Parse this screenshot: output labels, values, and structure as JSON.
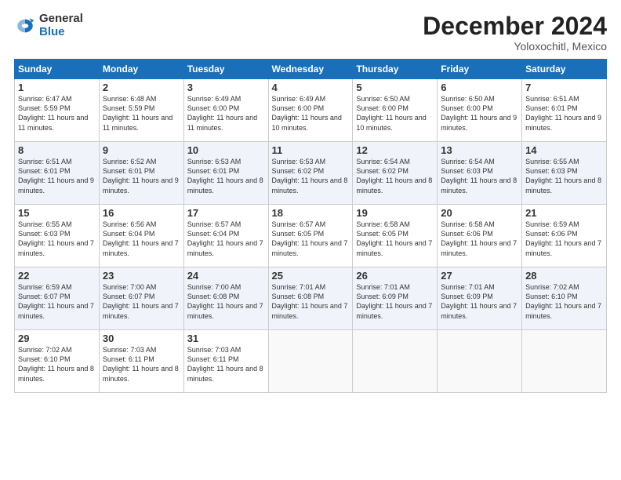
{
  "logo": {
    "general": "General",
    "blue": "Blue"
  },
  "title": "December 2024",
  "location": "Yoloxochitl, Mexico",
  "days_of_week": [
    "Sunday",
    "Monday",
    "Tuesday",
    "Wednesday",
    "Thursday",
    "Friday",
    "Saturday"
  ],
  "weeks": [
    [
      {
        "day": "1",
        "sunrise": "6:47 AM",
        "sunset": "5:59 PM",
        "daylight": "11 hours and 11 minutes."
      },
      {
        "day": "2",
        "sunrise": "6:48 AM",
        "sunset": "5:59 PM",
        "daylight": "11 hours and 11 minutes."
      },
      {
        "day": "3",
        "sunrise": "6:49 AM",
        "sunset": "6:00 PM",
        "daylight": "11 hours and 11 minutes."
      },
      {
        "day": "4",
        "sunrise": "6:49 AM",
        "sunset": "6:00 PM",
        "daylight": "11 hours and 10 minutes."
      },
      {
        "day": "5",
        "sunrise": "6:50 AM",
        "sunset": "6:00 PM",
        "daylight": "11 hours and 10 minutes."
      },
      {
        "day": "6",
        "sunrise": "6:50 AM",
        "sunset": "6:00 PM",
        "daylight": "11 hours and 9 minutes."
      },
      {
        "day": "7",
        "sunrise": "6:51 AM",
        "sunset": "6:01 PM",
        "daylight": "11 hours and 9 minutes."
      }
    ],
    [
      {
        "day": "8",
        "sunrise": "6:51 AM",
        "sunset": "6:01 PM",
        "daylight": "11 hours and 9 minutes."
      },
      {
        "day": "9",
        "sunrise": "6:52 AM",
        "sunset": "6:01 PM",
        "daylight": "11 hours and 9 minutes."
      },
      {
        "day": "10",
        "sunrise": "6:53 AM",
        "sunset": "6:01 PM",
        "daylight": "11 hours and 8 minutes."
      },
      {
        "day": "11",
        "sunrise": "6:53 AM",
        "sunset": "6:02 PM",
        "daylight": "11 hours and 8 minutes."
      },
      {
        "day": "12",
        "sunrise": "6:54 AM",
        "sunset": "6:02 PM",
        "daylight": "11 hours and 8 minutes."
      },
      {
        "day": "13",
        "sunrise": "6:54 AM",
        "sunset": "6:03 PM",
        "daylight": "11 hours and 8 minutes."
      },
      {
        "day": "14",
        "sunrise": "6:55 AM",
        "sunset": "6:03 PM",
        "daylight": "11 hours and 8 minutes."
      }
    ],
    [
      {
        "day": "15",
        "sunrise": "6:55 AM",
        "sunset": "6:03 PM",
        "daylight": "11 hours and 7 minutes."
      },
      {
        "day": "16",
        "sunrise": "6:56 AM",
        "sunset": "6:04 PM",
        "daylight": "11 hours and 7 minutes."
      },
      {
        "day": "17",
        "sunrise": "6:57 AM",
        "sunset": "6:04 PM",
        "daylight": "11 hours and 7 minutes."
      },
      {
        "day": "18",
        "sunrise": "6:57 AM",
        "sunset": "6:05 PM",
        "daylight": "11 hours and 7 minutes."
      },
      {
        "day": "19",
        "sunrise": "6:58 AM",
        "sunset": "6:05 PM",
        "daylight": "11 hours and 7 minutes."
      },
      {
        "day": "20",
        "sunrise": "6:58 AM",
        "sunset": "6:06 PM",
        "daylight": "11 hours and 7 minutes."
      },
      {
        "day": "21",
        "sunrise": "6:59 AM",
        "sunset": "6:06 PM",
        "daylight": "11 hours and 7 minutes."
      }
    ],
    [
      {
        "day": "22",
        "sunrise": "6:59 AM",
        "sunset": "6:07 PM",
        "daylight": "11 hours and 7 minutes."
      },
      {
        "day": "23",
        "sunrise": "7:00 AM",
        "sunset": "6:07 PM",
        "daylight": "11 hours and 7 minutes."
      },
      {
        "day": "24",
        "sunrise": "7:00 AM",
        "sunset": "6:08 PM",
        "daylight": "11 hours and 7 minutes."
      },
      {
        "day": "25",
        "sunrise": "7:01 AM",
        "sunset": "6:08 PM",
        "daylight": "11 hours and 7 minutes."
      },
      {
        "day": "26",
        "sunrise": "7:01 AM",
        "sunset": "6:09 PM",
        "daylight": "11 hours and 7 minutes."
      },
      {
        "day": "27",
        "sunrise": "7:01 AM",
        "sunset": "6:09 PM",
        "daylight": "11 hours and 7 minutes."
      },
      {
        "day": "28",
        "sunrise": "7:02 AM",
        "sunset": "6:10 PM",
        "daylight": "11 hours and 7 minutes."
      }
    ],
    [
      {
        "day": "29",
        "sunrise": "7:02 AM",
        "sunset": "6:10 PM",
        "daylight": "11 hours and 8 minutes."
      },
      {
        "day": "30",
        "sunrise": "7:03 AM",
        "sunset": "6:11 PM",
        "daylight": "11 hours and 8 minutes."
      },
      {
        "day": "31",
        "sunrise": "7:03 AM",
        "sunset": "6:11 PM",
        "daylight": "11 hours and 8 minutes."
      },
      null,
      null,
      null,
      null
    ]
  ]
}
